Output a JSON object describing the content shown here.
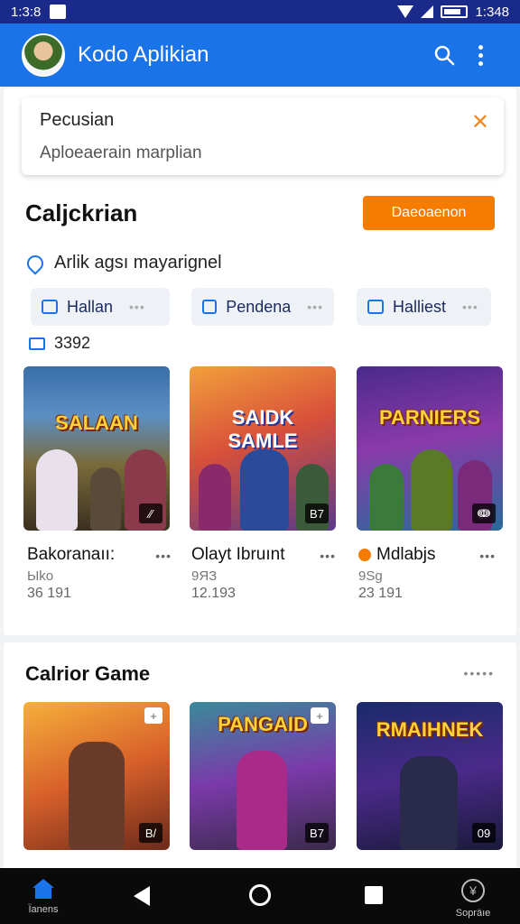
{
  "status_bar": {
    "time_left": "1:3:8",
    "time_right": "1:348"
  },
  "app_bar": {
    "title": "Kodo Aplikian",
    "icons": [
      "avatar",
      "search-icon",
      "more-vert-icon"
    ]
  },
  "search_card": {
    "title": "Pecusian",
    "placeholder": "Aploeaerain marplian"
  },
  "section": {
    "title": "Caljckrian",
    "cta_label": "Daeoaenon"
  },
  "location": {
    "text": "Arlik agsı mayarignel"
  },
  "chips": [
    {
      "label": "Hallan"
    },
    {
      "label": "Pendena"
    },
    {
      "label": "Halliest"
    }
  ],
  "count": {
    "value": "3392"
  },
  "games": [
    {
      "logo": "SALAAN",
      "badge": "∕∕",
      "name": "Bakoranaıı:",
      "sub": "Ыko",
      "stat": "36 191"
    },
    {
      "logo": "SAIDK SAMLE",
      "badge": "B7",
      "name": "Olayt Ibruınt",
      "sub": "9ЯЗ",
      "stat": "12.193"
    },
    {
      "logo": "PARNIERS",
      "badge": "ↈ",
      "name": "Mdlabjs",
      "sub": "9Sg",
      "stat": "23 191"
    }
  ],
  "section2": {
    "title": "Calrior Game",
    "more": "•••••"
  },
  "games2": [
    {
      "badge": "B/",
      "corner": "+"
    },
    {
      "logo": "PANGAID",
      "badge": "B7",
      "corner": "+"
    },
    {
      "logo": "RMAIHNEK",
      "badge": "09",
      "corner": ""
    }
  ],
  "nav": {
    "left_label": "Ïanens",
    "right_label": "Sopräıe"
  },
  "colors": {
    "primary": "#1a73e8",
    "status": "#1a2a8a",
    "accent": "#f57c00"
  }
}
